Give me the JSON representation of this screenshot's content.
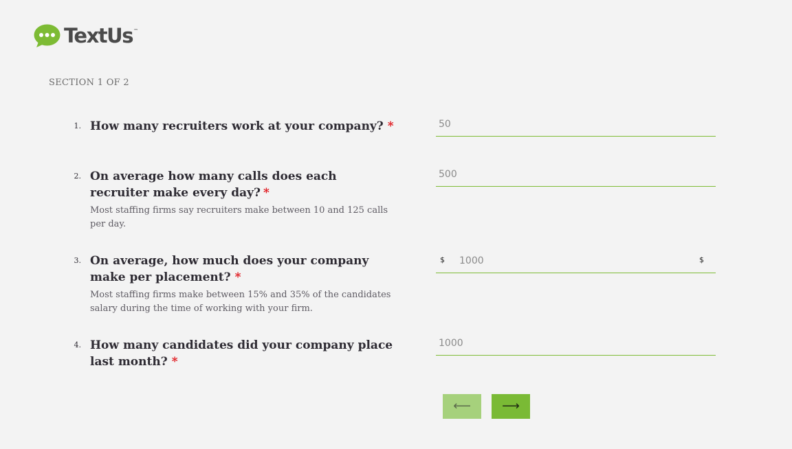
{
  "brand": {
    "name": "TextUs",
    "trademark": "™",
    "icon": "chat-bubble-icon",
    "color": "#7dbb34"
  },
  "section_label": "SECTION 1 OF 2",
  "questions": [
    {
      "number": "1.",
      "title": "How many recruiters work at your company?",
      "required_mark": "*",
      "description": "",
      "value": "50",
      "currency_left": "",
      "currency_right": ""
    },
    {
      "number": "2.",
      "title": "On average how many calls does each recruiter make every day?",
      "required_mark": "*",
      "description": "Most staffing firms say recruiters make between 10 and 125 calls per day.",
      "value": "500",
      "currency_left": "",
      "currency_right": ""
    },
    {
      "number": "3.",
      "title": "On average, how much does your company make per placement?",
      "required_mark": "*",
      "description": "Most staffing firms make between 15% and 35% of the candidates salary during the time of working with your firm.",
      "value": "1000",
      "currency_left": "$",
      "currency_right": "$"
    },
    {
      "number": "4.",
      "title": "How many candidates did your company place last month?",
      "required_mark": "*",
      "description": "",
      "value": "1000",
      "currency_left": "",
      "currency_right": ""
    }
  ],
  "navigation": {
    "prev_icon": "arrow-left-icon",
    "prev_glyph": "⟵",
    "next_icon": "arrow-right-icon",
    "next_glyph": "⟶"
  },
  "colors": {
    "accent": "#7dbb34",
    "accent_light": "#a6d17c",
    "required": "#e0151b",
    "background": "#f3f3f3"
  }
}
